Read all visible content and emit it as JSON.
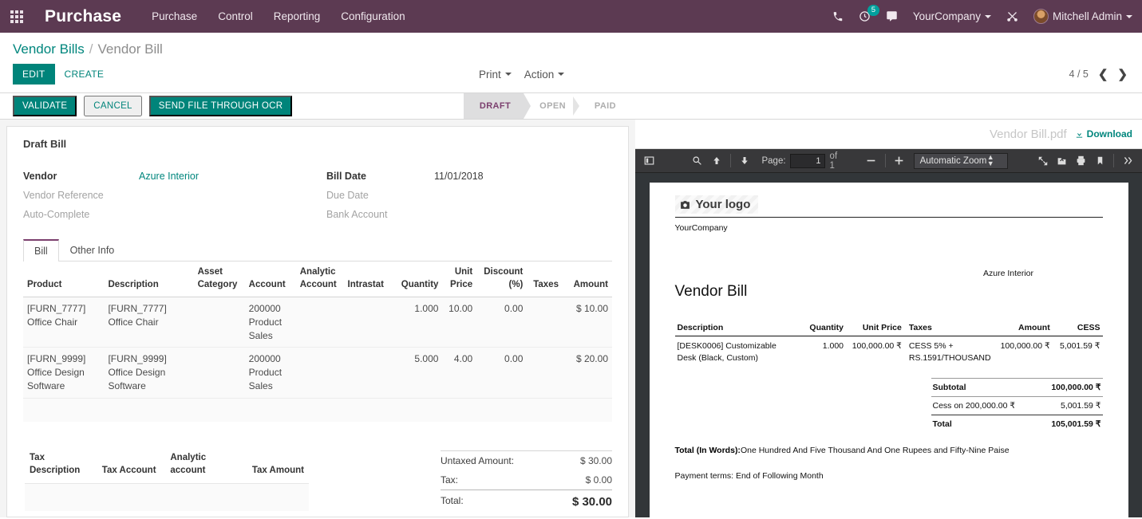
{
  "navbar": {
    "apps_icon": "apps-grid-icon",
    "brand": "Purchase",
    "menu": [
      "Purchase",
      "Control",
      "Reporting",
      "Configuration"
    ],
    "phone_icon": "phone-icon",
    "activity_icon": "clock-icon",
    "activity_count": "5",
    "messages_icon": "chat-icon",
    "company": "YourCompany",
    "debug_icon": "bug-tools-icon",
    "user": "Mitchell Admin"
  },
  "control": {
    "breadcrumb_root": "Vendor Bills",
    "breadcrumb_sep": "/",
    "breadcrumb_current": "Vendor Bill",
    "edit_label": "EDIT",
    "create_label": "CREATE",
    "print_label": "Print",
    "action_label": "Action",
    "pager": "4 / 5",
    "prev_icon": "chevron-left-icon",
    "next_icon": "chevron-right-icon"
  },
  "statusbar": {
    "validate_label": "VALIDATE",
    "cancel_label": "CANCEL",
    "ocr_label": "SEND FILE THROUGH OCR",
    "stages": [
      "DRAFT",
      "OPEN",
      "PAID"
    ],
    "active_stage": "DRAFT"
  },
  "form": {
    "title": "Draft Bill",
    "fields": [
      {
        "label": "Vendor",
        "value": "Azure Interior",
        "muted": false,
        "link": true
      },
      {
        "label": "Bill Date",
        "value": "11/01/2018",
        "muted": false,
        "link": false
      },
      {
        "label": "Vendor Reference",
        "value": "",
        "muted": true,
        "link": false
      },
      {
        "label": "Due Date",
        "value": "",
        "muted": true,
        "link": false
      },
      {
        "label": "Auto-Complete",
        "value": "",
        "muted": true,
        "link": false
      },
      {
        "label": "Bank Account",
        "value": "",
        "muted": true,
        "link": false
      }
    ],
    "tabs": [
      {
        "label": "Bill",
        "active": true
      },
      {
        "label": "Other Info",
        "active": false
      }
    ],
    "line_headers": [
      "Product",
      "Description",
      "Asset Category",
      "Account",
      "Analytic Account",
      "Intrastat",
      "Quantity",
      "Unit Price",
      "Discount (%)",
      "Taxes",
      "Amount"
    ],
    "lines": [
      {
        "product": "[FURN_7777] Office Chair",
        "description": "[FURN_7777] Office Chair",
        "asset_category": "",
        "account": "200000 Product Sales",
        "analytic_account": "",
        "intrastat": "",
        "quantity": "1.000",
        "unit_price": "10.00",
        "discount": "0.00",
        "taxes": "",
        "amount": "$ 10.00"
      },
      {
        "product": "[FURN_9999] Office Design Software",
        "description": "[FURN_9999] Office Design Software",
        "asset_category": "",
        "account": "200000 Product Sales",
        "analytic_account": "",
        "intrastat": "",
        "quantity": "5.000",
        "unit_price": "4.00",
        "discount": "0.00",
        "taxes": "",
        "amount": "$ 20.00"
      }
    ],
    "tax_headers": [
      "Tax Description",
      "Tax Account",
      "Analytic account",
      "Tax Amount"
    ],
    "totals": [
      {
        "label": "Untaxed Amount:",
        "value": "$ 30.00"
      },
      {
        "label": "Tax:",
        "value": "$ 0.00"
      }
    ],
    "grand_total": {
      "label": "Total:",
      "value": "$ 30.00"
    }
  },
  "pdf": {
    "filename": "Vendor Bill.pdf",
    "download_label": "Download",
    "download_icon": "download-icon",
    "toolbar": {
      "sidebar_icon": "sidebar-toggle-icon",
      "find_icon": "search-icon",
      "prev_page_icon": "arrow-up-icon",
      "next_page_icon": "arrow-down-icon",
      "page_label": "Page:",
      "page_value": "1",
      "page_total": "of 1",
      "zoom_out_icon": "minus-icon",
      "zoom_in_icon": "plus-icon",
      "zoom_level": "Automatic Zoom",
      "presentation_icon": "fullscreen-icon",
      "open_file_icon": "open-file-icon",
      "print_icon": "print-icon",
      "bookmark_icon": "bookmark-icon",
      "more_icon": "double-chevron-right-icon"
    },
    "document": {
      "logo_placeholder": "Your logo",
      "logo_icon": "camera-icon",
      "company_name": "YourCompany",
      "recipient": "Azure Interior",
      "title": "Vendor Bill",
      "table_headers": [
        "Description",
        "Quantity",
        "Unit Price",
        "Taxes",
        "Amount",
        "CESS"
      ],
      "rows": [
        {
          "description": "[DESK0006] Customizable Desk (Black, Custom)",
          "quantity": "1.000",
          "unit_price": "100,000.00 ₹",
          "taxes": "CESS 5% + RS.1591/THOUSAND",
          "amount": "100,000.00 ₹",
          "cess": "5,001.59 ₹"
        }
      ],
      "totals": [
        {
          "label": "Subtotal",
          "value": "100,000.00 ₹",
          "bold": true
        },
        {
          "label": "Cess on 200,000.00 ₹",
          "value": "5,001.59 ₹",
          "bold": false
        },
        {
          "label": "Total",
          "value": "105,001.59 ₹",
          "bold": true
        }
      ],
      "total_in_words_label": "Total (In Words):",
      "total_in_words_value": "One Hundred And Five Thousand And One Rupees and Fifty-Nine Paise",
      "payment_terms": "Payment terms: End of Following Month"
    }
  }
}
